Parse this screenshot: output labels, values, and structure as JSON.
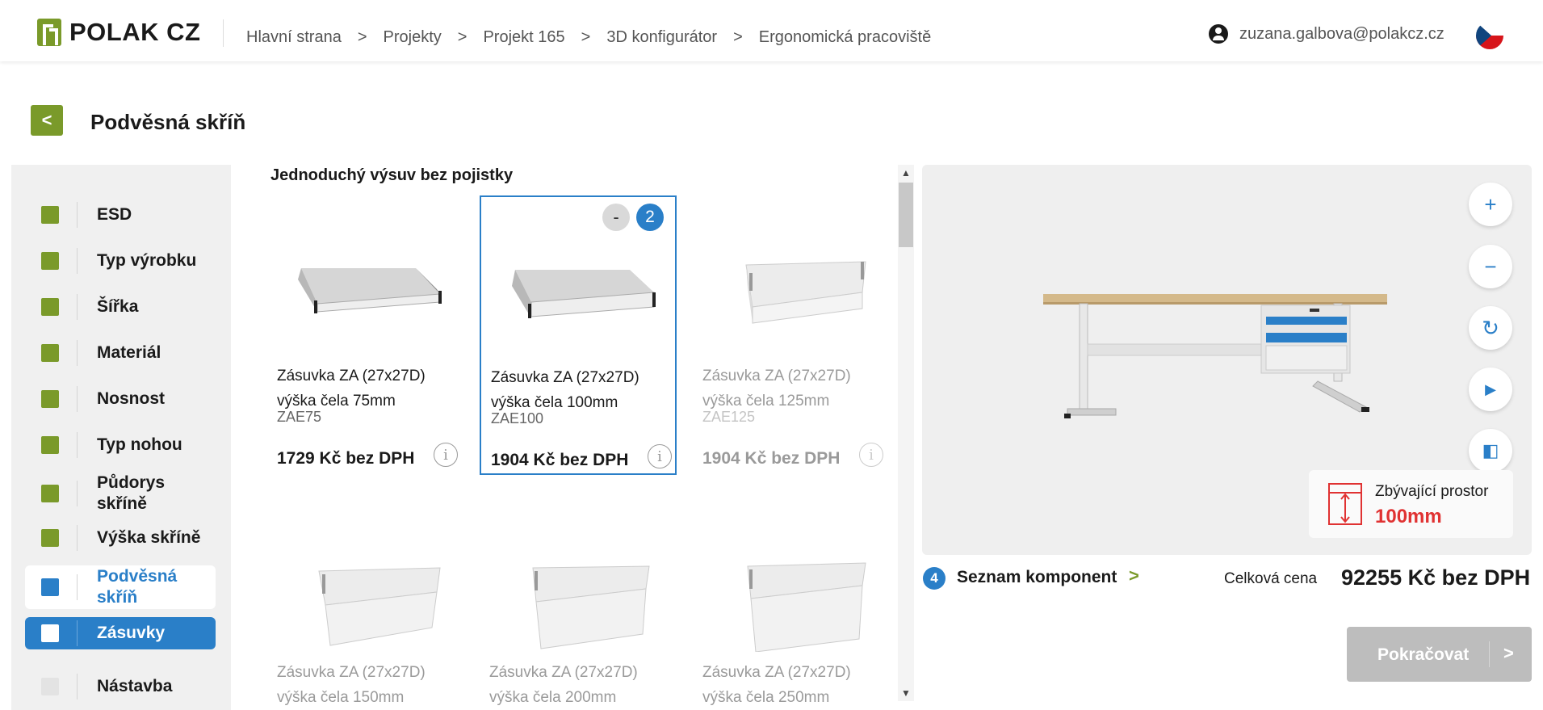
{
  "header": {
    "logo_text": "POLAK CZ",
    "breadcrumb": [
      "Hlavní strana",
      "Projekty",
      "Projekt 165",
      "3D konfigurátor",
      "Ergonomická pracoviště"
    ],
    "breadcrumb_separator": ">",
    "user_email": "zuzana.galbova@polakcz.cz",
    "language_flag": "cz-flag-icon"
  },
  "page": {
    "back_icon": "chevron-left-icon",
    "back_glyph": "<",
    "title": "Podvěsná skříň"
  },
  "sidebar": {
    "items": [
      {
        "label": "ESD",
        "state": "done"
      },
      {
        "label": "Typ výrobku",
        "state": "done"
      },
      {
        "label": "Šířka",
        "state": "done"
      },
      {
        "label": "Materiál",
        "state": "done"
      },
      {
        "label": "Nosnost",
        "state": "done"
      },
      {
        "label": "Typ nohou",
        "state": "done"
      },
      {
        "label": "Půdorys skříně",
        "state": "done"
      },
      {
        "label": "Výška skříně",
        "state": "done"
      },
      {
        "label": "Podvěsná skříň",
        "state": "current"
      },
      {
        "label": "Zásuvky",
        "state": "selected"
      },
      {
        "label": "Nástavba",
        "state": "disabled"
      }
    ]
  },
  "products": {
    "section_title": "Jednoduchý výsuv bez pojistky",
    "items": [
      {
        "name": "Zásuvka ZA (27x27D)",
        "height_text": "výška čela 75mm",
        "code": "ZAE75",
        "price": "1729 Kč bez DPH"
      },
      {
        "name": "Zásuvka ZA (27x27D)",
        "height_text": "výška čela 100mm",
        "code": "ZAE100",
        "price": "1904 Kč bez DPH",
        "quantity": "2",
        "minus": "-"
      },
      {
        "name": "Zásuvka ZA (27x27D)",
        "height_text": "výška čela 125mm",
        "code": "ZAE125",
        "price": "1904 Kč bez DPH"
      },
      {
        "name": "Zásuvka ZA (27x27D)",
        "height_text": "výška čela 150mm"
      },
      {
        "name": "Zásuvka ZA (27x27D)",
        "height_text": "výška čela 200mm"
      },
      {
        "name": "Zásuvka ZA (27x27D)",
        "height_text": "výška čela 250mm"
      }
    ],
    "info_glyph": "i"
  },
  "viewer": {
    "controls": [
      {
        "icon": "zoom-in-icon",
        "glyph": "+"
      },
      {
        "icon": "zoom-out-icon",
        "glyph": "−"
      },
      {
        "icon": "rotate-icon",
        "glyph": "↻"
      },
      {
        "icon": "play-icon",
        "glyph": "▶"
      },
      {
        "icon": "split-view-icon",
        "glyph": "◧"
      }
    ],
    "remaining_space_label": "Zbývající prostor",
    "remaining_space_value": "100mm"
  },
  "summary": {
    "step_number": "4",
    "components_label": "Seznam komponent",
    "chevron": ">",
    "total_label": "Celková cena",
    "total_value": "92255 Kč bez DPH"
  },
  "actions": {
    "continue_label": "Pokračovat",
    "continue_chevron": ">"
  },
  "colors": {
    "brand_green": "#7a9a2a",
    "accent_blue": "#2a7fc8",
    "warning_red": "#e03232",
    "disabled_gray": "#bdbdbd"
  }
}
